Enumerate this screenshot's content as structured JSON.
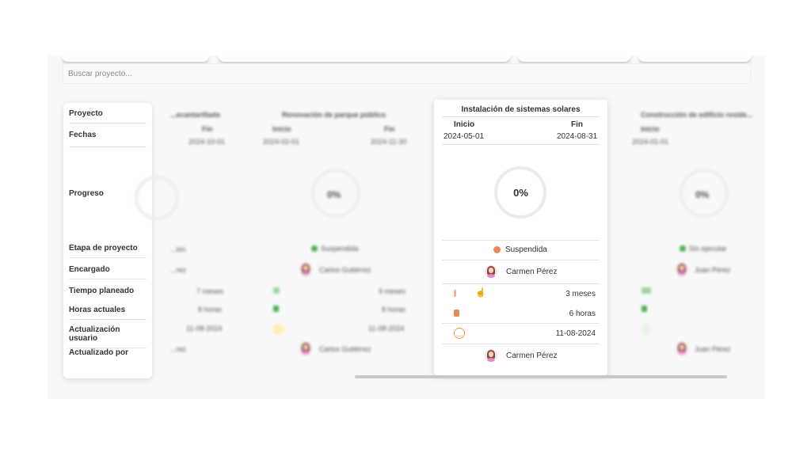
{
  "search": {
    "placeholder": "Buscar proyecto..."
  },
  "row_labels": [
    "Proyecto",
    "Fechas",
    "Progreso",
    "Etapa de proyecto",
    "Encargado",
    "Tiempo planeado",
    "Horas actuales",
    "Actualización usuario",
    "Actualizado por"
  ],
  "projects": [
    {
      "name": "...ecantarillado",
      "fin_label": "Fin",
      "fin": "2024-10-01",
      "stage": "...ión",
      "owner": "...rez",
      "planned": "7 meses",
      "hours": "8 horas",
      "updated": "11-08-2024",
      "updated_by": "...rez"
    },
    {
      "name": "Renovación de parque público",
      "inicio_label": "Inicio",
      "fin_label": "Fin",
      "inicio": "2024-02-01",
      "fin": "2024-11-30",
      "progress": "0%",
      "stage": "Suspendida",
      "stage_color": "#4caf50",
      "owner": "Carlos Gutiérrez",
      "planned": "9 meses",
      "hours": "8 horas",
      "updated": "11-08-2024",
      "updated_by": "Carlos Gutiérrez"
    },
    {
      "name": "Instalación de sistemas solares",
      "inicio_label": "Inicio",
      "fin_label": "Fin",
      "inicio": "2024-05-01",
      "fin": "2024-08-31",
      "progress": "0%",
      "stage": "Suspendida",
      "stage_color": "#e8895a",
      "owner": "Carmen Pérez",
      "planned": "3 meses",
      "hours": "6 horas",
      "updated": "11-08-2024",
      "updated_by": "Carmen Pérez"
    },
    {
      "name": "Construcción de edificio reside...",
      "inicio_label": "Inicio",
      "inicio": "2024-01-01",
      "progress": "0%",
      "stage": "Sin ejecutar",
      "stage_color": "#4caf50",
      "owner": "Juan Pérez",
      "updated_by": "Juan Pérez"
    }
  ],
  "icons": {
    "planned": "bar-icon",
    "hours": "square-icon",
    "updated": "smiley-icon",
    "cursor": "hand-pointer-icon"
  }
}
